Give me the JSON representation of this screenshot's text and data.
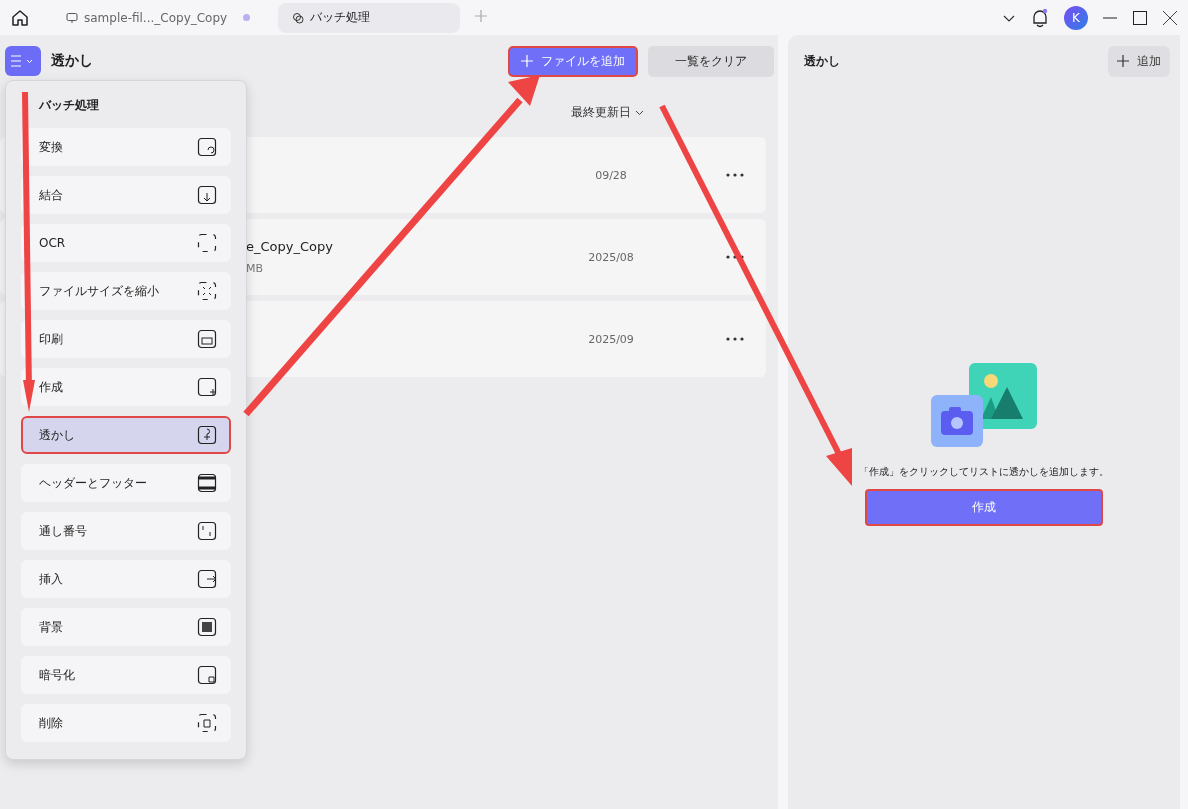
{
  "tabs": [
    {
      "label": "sample-fil..._Copy_Copy",
      "selected": false,
      "unsaved": true
    },
    {
      "label": "バッチ処理",
      "selected": true,
      "unsaved": false
    }
  ],
  "avatar": "K",
  "header": {
    "title": "透かし",
    "add_files": {
      "label": "ファイルを追加",
      "annotated": true
    },
    "clear": {
      "label": "一覧をクリア",
      "annotated": false
    }
  },
  "sort": {
    "label": "最終更新日"
  },
  "files": [
    {
      "date": "09/28"
    },
    {
      "name": "e_Copy_Copy",
      "size": "MB",
      "date": "2025/08"
    },
    {
      "date": "2025/09"
    }
  ],
  "menu": {
    "title": "バッチ処理",
    "items": [
      {
        "label": "変換",
        "selected": false,
        "annotated": false
      },
      {
        "label": "結合",
        "selected": false,
        "annotated": false
      },
      {
        "label": "OCR",
        "selected": false,
        "annotated": false
      },
      {
        "label": "ファイルサイズを縮小",
        "selected": false,
        "annotated": false
      },
      {
        "label": "印刷",
        "selected": false,
        "annotated": false
      },
      {
        "label": "作成",
        "selected": false,
        "annotated": false
      },
      {
        "label": "透かし",
        "selected": true,
        "annotated": true
      },
      {
        "label": "ヘッダーとフッター",
        "selected": false,
        "annotated": false
      },
      {
        "label": "通し番号",
        "selected": false,
        "annotated": false
      },
      {
        "label": "挿入",
        "selected": false,
        "annotated": false
      },
      {
        "label": "背景",
        "selected": false,
        "annotated": false
      },
      {
        "label": "暗号化",
        "selected": false,
        "annotated": false
      },
      {
        "label": "削除",
        "selected": false,
        "annotated": false
      }
    ]
  },
  "panel": {
    "title": "透かし",
    "add": "追加",
    "hint": "「作成」をクリックしてリストに透かしを追加します。",
    "create": {
      "label": "作成",
      "annotated": true
    }
  }
}
